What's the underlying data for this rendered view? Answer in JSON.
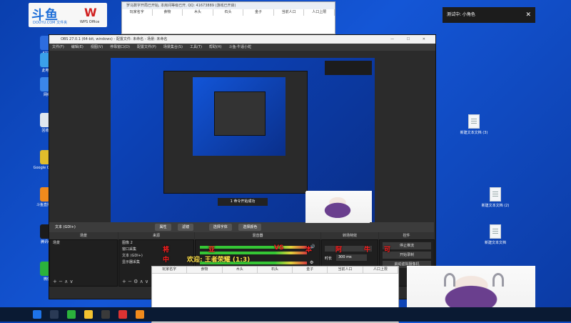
{
  "desktop": {
    "logo": {
      "brand_text": "斗鱼",
      "brand_sub": "DOUYU.COM 文件夹",
      "wps_text": "WPS Office"
    },
    "left_icons": [
      {
        "label": "6777",
        "color": "#2d6de0"
      },
      {
        "label": "此电脑",
        "color": "#3aa0ea"
      },
      {
        "label": "网络",
        "color": "#3b86e8"
      },
      {
        "label": "回收站",
        "color": "#dfe6ee"
      },
      {
        "label": "Google Chrome",
        "color": "#e0bd2b"
      },
      {
        "label": "斗鱼直播伴侣",
        "color": "#f08a1c"
      },
      {
        "label": "腾讯QQ",
        "color": "#1b1b1b"
      },
      {
        "label": "微信",
        "color": "#2bb23c"
      }
    ],
    "right_files": [
      {
        "label": "新建文本文档 (3)"
      },
      {
        "label": "新建文本文档 (2)"
      },
      {
        "label": "新建文本文档"
      }
    ]
  },
  "popup": {
    "text": "测试中: 小角色",
    "close": "✕"
  },
  "top_sheet": {
    "title": "罗马数字开局已开始, 本房间等级已开, QQ: 41673889 (游戏已开启)",
    "headers": [
      "玩家名字",
      "食物",
      "木头",
      "石头",
      "金子",
      "当前人口",
      "人口上限"
    ]
  },
  "obs": {
    "title": "OBS 27.0.1 (64-bit, windows) - 配置文件: 未命名 - 场景: 未命名",
    "window_controls": "— ☐ ✕",
    "menu": [
      "文件(F)",
      "编辑(E)",
      "视图(V)",
      "停靠窗口(D)",
      "配置文件(P)",
      "场景集合(S)",
      "工具(T)",
      "帮助(H)",
      "斗鱼·牛逼小蛇"
    ],
    "source_bar": {
      "label": "文本 (GDI+)",
      "properties": "属性",
      "filters": "滤镜",
      "select_font": "选择字体",
      "select_color": "选择颜色"
    },
    "docks": {
      "scenes": "场景",
      "sources": "来源",
      "mixer": "混音器",
      "transitions": "转场特效",
      "controls": "控件"
    },
    "scene_item": "场景",
    "sources": [
      "图像 2",
      "窗口采集",
      "文本 (GDI+)",
      "显示器采集"
    ],
    "transition_label": "时长",
    "transition_value": "300 ms",
    "controls": [
      "停止推流",
      "开始录制",
      "启动虚拟摄像机"
    ],
    "danmu_preview": "1 命令开始成功"
  },
  "overlay_text": {
    "red": [
      "将",
      "亚",
      "VS",
      "本",
      "阿",
      "牛",
      "可",
      "中"
    ],
    "yellow": "欢迎: 王者荣耀 (1:3)"
  },
  "bottom_sheet": {
    "headers": [
      "玩家名字",
      "食物",
      "木头",
      "石头",
      "金子",
      "当前人口",
      "人口上限"
    ]
  }
}
